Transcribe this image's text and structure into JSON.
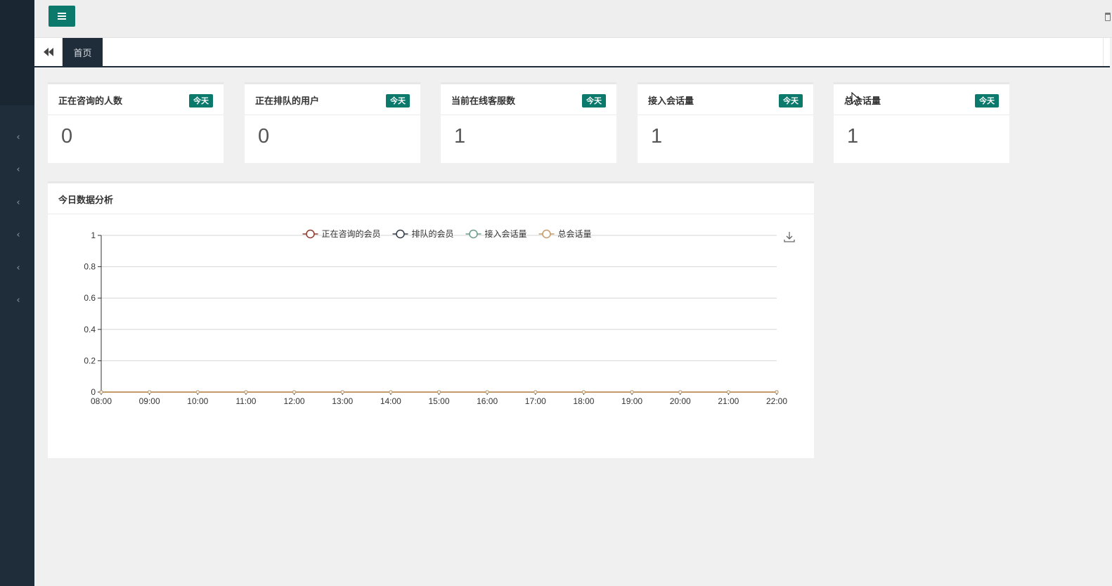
{
  "header": {
    "menu_icon": "hamburger-icon",
    "corner_icon": "trash-icon"
  },
  "tabs": {
    "back_icon": "double-chevron-left-icon",
    "home_label": "首页"
  },
  "sidebar": {
    "items": [
      {
        "icon": "chevron-left-icon"
      },
      {
        "icon": "chevron-left-icon"
      },
      {
        "icon": "chevron-left-icon"
      },
      {
        "icon": "chevron-left-icon"
      },
      {
        "icon": "chevron-left-icon"
      },
      {
        "icon": "chevron-left-icon"
      }
    ]
  },
  "stats": [
    {
      "title": "正在咨询的人数",
      "badge": "今天",
      "value": "0"
    },
    {
      "title": "正在排队的用户",
      "badge": "今天",
      "value": "0"
    },
    {
      "title": "当前在线客服数",
      "badge": "今天",
      "value": "1"
    },
    {
      "title": "接入会话量",
      "badge": "今天",
      "value": "1"
    },
    {
      "title": "总会话量",
      "badge": "今天",
      "value": "1"
    }
  ],
  "analysis": {
    "title": "今日数据分析",
    "download_icon": "download-icon"
  },
  "colors": {
    "accent": "#0b7a6c",
    "sidebar": "#1f2d3a",
    "series": [
      "#8b3a2b",
      "#2f3a45",
      "#6a9a8c",
      "#c39a6b"
    ]
  },
  "chart_data": {
    "type": "line",
    "categories": [
      "08:00",
      "09:00",
      "10:00",
      "11:00",
      "12:00",
      "13:00",
      "14:00",
      "15:00",
      "16:00",
      "17:00",
      "18:00",
      "19:00",
      "20:00",
      "21:00",
      "22:00"
    ],
    "series": [
      {
        "name": "正在咨询的会员",
        "values": [
          0,
          0,
          0,
          0,
          0,
          0,
          0,
          0,
          0,
          0,
          0,
          0,
          0,
          0,
          0
        ]
      },
      {
        "name": "排队的会员",
        "values": [
          0,
          0,
          0,
          0,
          0,
          0,
          0,
          0,
          0,
          0,
          0,
          0,
          0,
          0,
          0
        ]
      },
      {
        "name": "接入会话量",
        "values": [
          0,
          0,
          0,
          0,
          0,
          0,
          0,
          0,
          0,
          0,
          0,
          0,
          0,
          0,
          0
        ]
      },
      {
        "name": "总会话量",
        "values": [
          0,
          0,
          0,
          0,
          0,
          0,
          0,
          0,
          0,
          0,
          0,
          0,
          0,
          0,
          0
        ]
      }
    ],
    "yticks": [
      "0",
      "0.2",
      "0.4",
      "0.6",
      "0.8",
      "1"
    ],
    "ylim": [
      0,
      1
    ],
    "grid": true,
    "legend_position": "top-center"
  }
}
